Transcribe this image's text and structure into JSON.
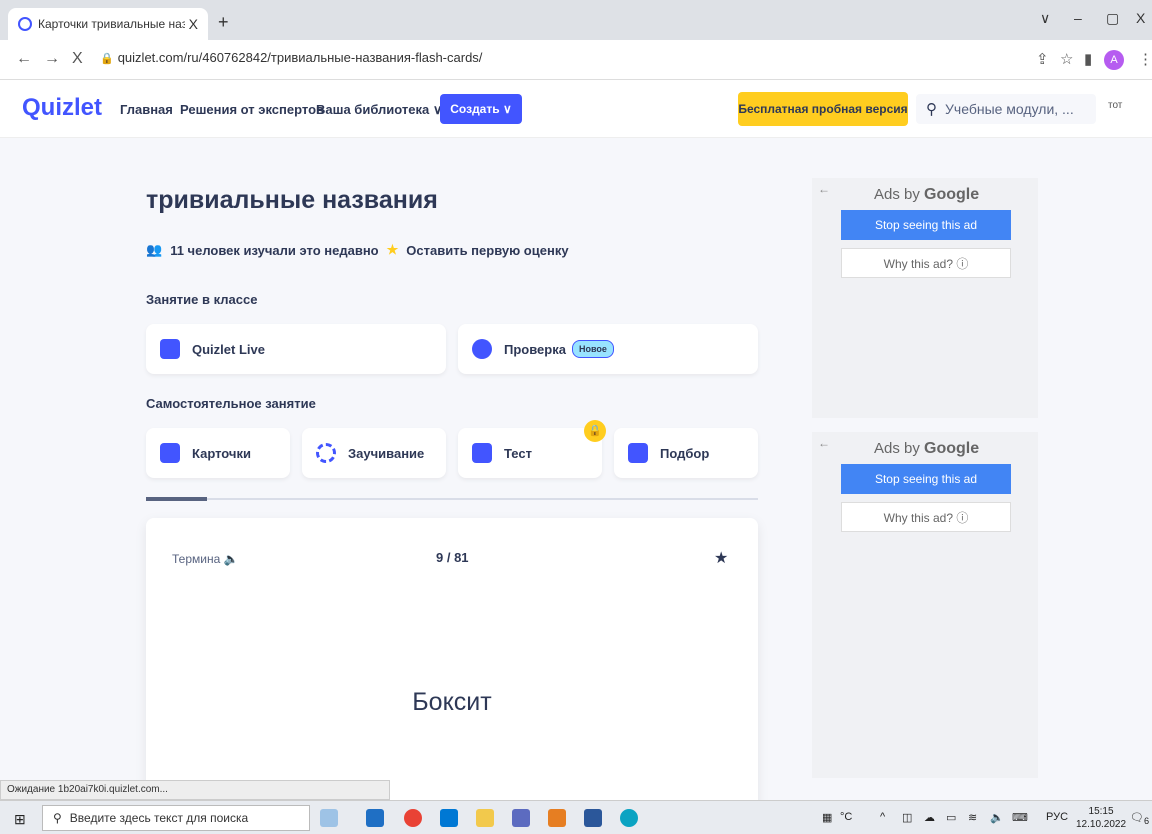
{
  "browser": {
    "tab_title": "Карточки тривиальные назван",
    "tab_close": "X",
    "new_tab": "+",
    "url": "quizlet.com/ru/460762842/тривиальные-названия-flash-cards/",
    "back": "←",
    "forward": "→",
    "stop": "X",
    "minimize": "–",
    "maximize": "▢",
    "close": "X",
    "tab_menu": "∨",
    "profile_initial": "A",
    "status": "Ожидание 1b20ai7k0i.quizlet.com..."
  },
  "header": {
    "logo": "Quizlet",
    "nav": [
      "Главная",
      "Решения от экспертов",
      "Ваша библиотека ∨"
    ],
    "create_label": "Создать ∨",
    "trial_label": "Бесплатная пробная версия",
    "search_placeholder": "Учебные модули, ...",
    "avatar_alt": "тот"
  },
  "set": {
    "title": "тривиальные названия",
    "studied": "11 человек изучали это недавно",
    "rate_label": "Оставить первую оценку",
    "class_section": "Занятие в классе",
    "self_section": "Самостоятельное занятие",
    "class_modes": [
      {
        "label": "Quizlet Live",
        "color": "#4255ff"
      },
      {
        "label": "Проверка",
        "color": "#4255ff",
        "badge": "Новое"
      }
    ],
    "self_modes": [
      {
        "label": "Карточки",
        "color": "#4255ff"
      },
      {
        "label": "Заучивание",
        "color": "#4255ff"
      },
      {
        "label": "Тест",
        "color": "#4255ff"
      },
      {
        "label": "Подбор",
        "color": "#4255ff"
      }
    ],
    "progress_fraction": 0.1
  },
  "flashcard": {
    "side_label": "Термина",
    "counter": "9 / 81",
    "word": "Боксит"
  },
  "ads": [
    {
      "by": "Ads by",
      "brand": "Google",
      "stop": "Stop seeing this ad",
      "why": "Why this ad? ⓘ"
    },
    {
      "by": "Ads by",
      "brand": "Google",
      "stop": "Stop seeing this ad",
      "why": "Why this ad? ⓘ"
    }
  ],
  "taskbar": {
    "search_placeholder": "Введите здесь текст для поиска",
    "temp": "°C",
    "lang": "РУС",
    "time": "15:15",
    "date": "12.10.2022",
    "notif_count": "6"
  }
}
